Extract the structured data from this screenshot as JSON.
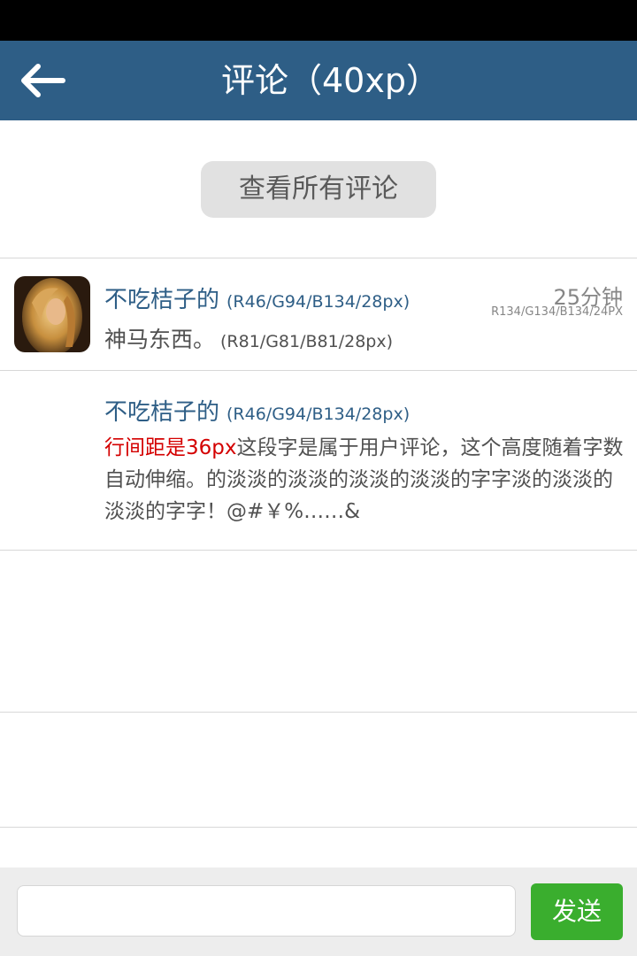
{
  "header": {
    "back_icon": "arrow-left-icon",
    "title": "评论（40xp）"
  },
  "view_all": {
    "label": "查看所有评论"
  },
  "comments": [
    {
      "name": "不吃桔子的",
      "name_spec": "(R46/G94/B134/28px)",
      "text": "神马东西。",
      "text_spec": "(R81/G81/B81/28px)",
      "time": "25分钟",
      "time_spec": "R134/G134/B134/24PX"
    },
    {
      "name": "不吃桔子的",
      "name_spec": "(R46/G94/B134/28px)",
      "note": "行间距是36px",
      "text": "这段字是属于用户评论，这个高度随着字数自动伸缩。的淡淡的淡淡的淡淡的淡淡的字字淡的淡淡的淡淡的字字！@#￥%……&"
    }
  ],
  "footer": {
    "input_placeholder": "",
    "send_label": "发送"
  },
  "colors": {
    "header_bg": "#2e5e86",
    "name": "#2e5e86",
    "body_text": "#515151",
    "time": "#868686",
    "note": "#d40000",
    "send_bg": "#3aae2e"
  }
}
